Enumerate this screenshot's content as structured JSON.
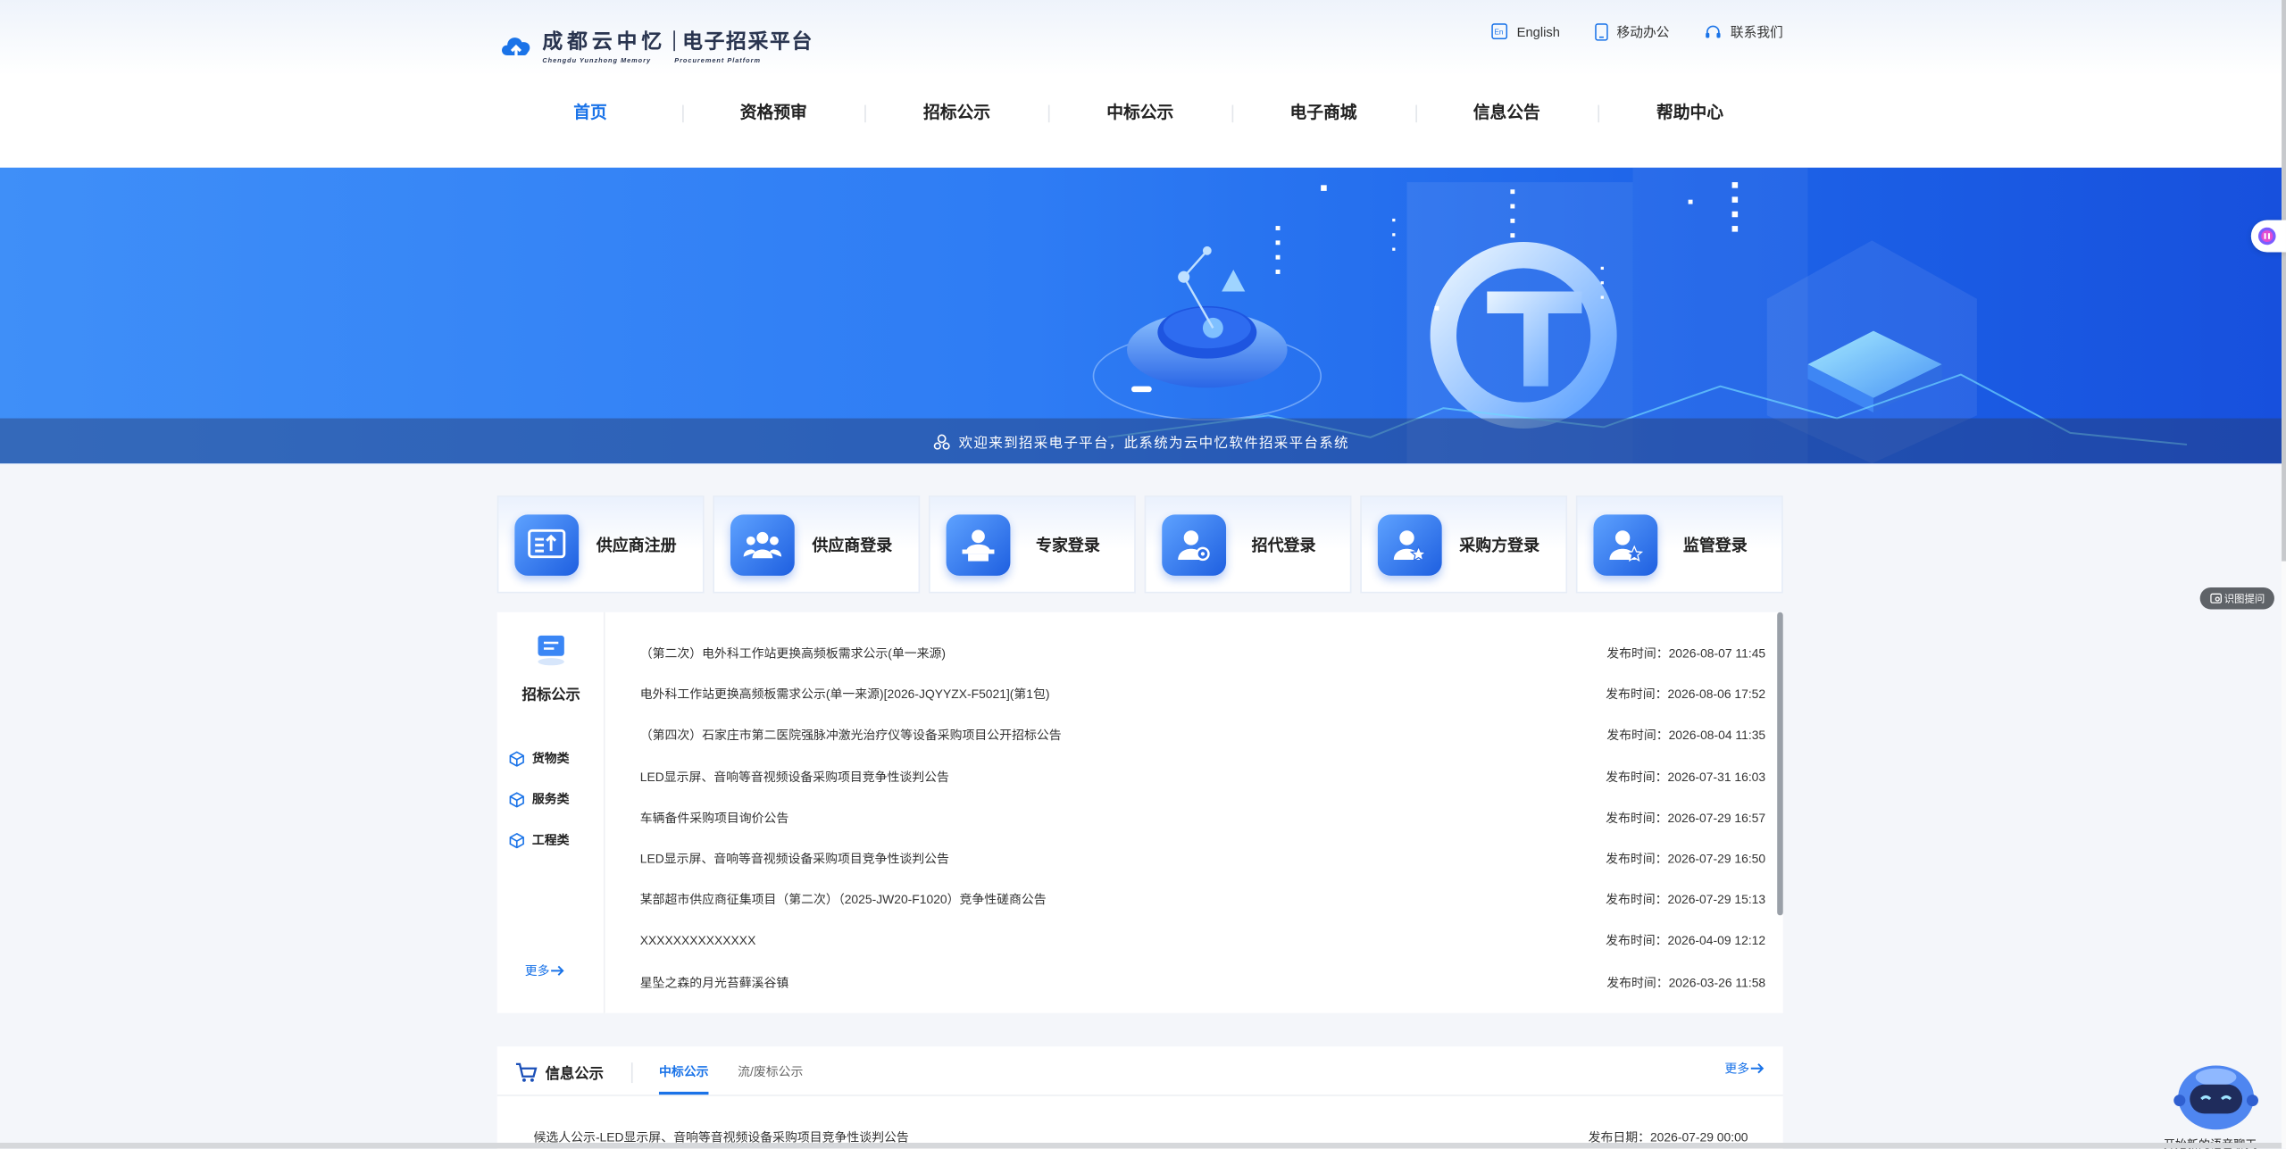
{
  "logo": {
    "cn_name": "成都云中忆",
    "cn_platform": "电子招采平台",
    "en_name": "Chengdu Yunzhong Memory",
    "en_platform": "Procurement Platform"
  },
  "top_links": {
    "english": "English",
    "mobile": "移动办公",
    "contact": "联系我们"
  },
  "nav": [
    "首页",
    "资格预审",
    "招标公示",
    "中标公示",
    "电子商城",
    "信息公告",
    "帮助中心"
  ],
  "banner": {
    "welcome": "欢迎来到招采电子平台，此系统为云中忆软件招采平台系统"
  },
  "login_cards": [
    "供应商注册",
    "供应商登录",
    "专家登录",
    "招代登录",
    "采购方登录",
    "监管登录"
  ],
  "tender": {
    "title": "招标公示",
    "categories": [
      "货物类",
      "服务类",
      "工程类"
    ],
    "more": "更多",
    "rows": [
      {
        "title": "（第二次）电外科工作站更换高频板需求公示(单一来源)",
        "time": "发布时间：2026-08-07 11:45"
      },
      {
        "title": "电外科工作站更换高频板需求公示(单一来源)[2026-JQYYZX-F5021](第1包)",
        "time": "发布时间：2026-08-06 17:52"
      },
      {
        "title": "（第四次）石家庄市第二医院强脉冲激光治疗仪等设备采购项目公开招标公告",
        "time": "发布时间：2026-08-04 11:35"
      },
      {
        "title": "LED显示屏、音响等音视频设备采购项目竞争性谈判公告",
        "time": "发布时间：2026-07-31 16:03"
      },
      {
        "title": "车辆备件采购项目询价公告",
        "time": "发布时间：2026-07-29 16:57"
      },
      {
        "title": "LED显示屏、音响等音视频设备采购项目竞争性谈判公告",
        "time": "发布时间：2026-07-29 16:50"
      },
      {
        "title": "某部超市供应商征集项目（第二次）（2025-JW20-F1020）竞争性磋商公告",
        "time": "发布时间：2026-07-29 15:13"
      },
      {
        "title": "XXXXXXXXXXXXXX",
        "time": "发布时间：2026-04-09 12:12"
      },
      {
        "title": "星坠之森的月光苔藓溪谷镇",
        "time": "发布时间：2026-03-26 11:58"
      }
    ]
  },
  "info": {
    "title": "信息公示",
    "tabs": [
      "中标公示",
      "流/废标公示"
    ],
    "more": "更多",
    "row": {
      "title": "候选人公示-LED显示屏、音响等音视频设备采购项目竞争性谈判公告",
      "date": "发布日期：2026-07-29 00:00"
    }
  },
  "widgets": {
    "ask": "识图提问",
    "robot_label": "开始新的语音聊天"
  },
  "colors": {
    "primary": "#1a73e8",
    "banner_start": "#3f8ff8",
    "banner_end": "#1750dd"
  }
}
